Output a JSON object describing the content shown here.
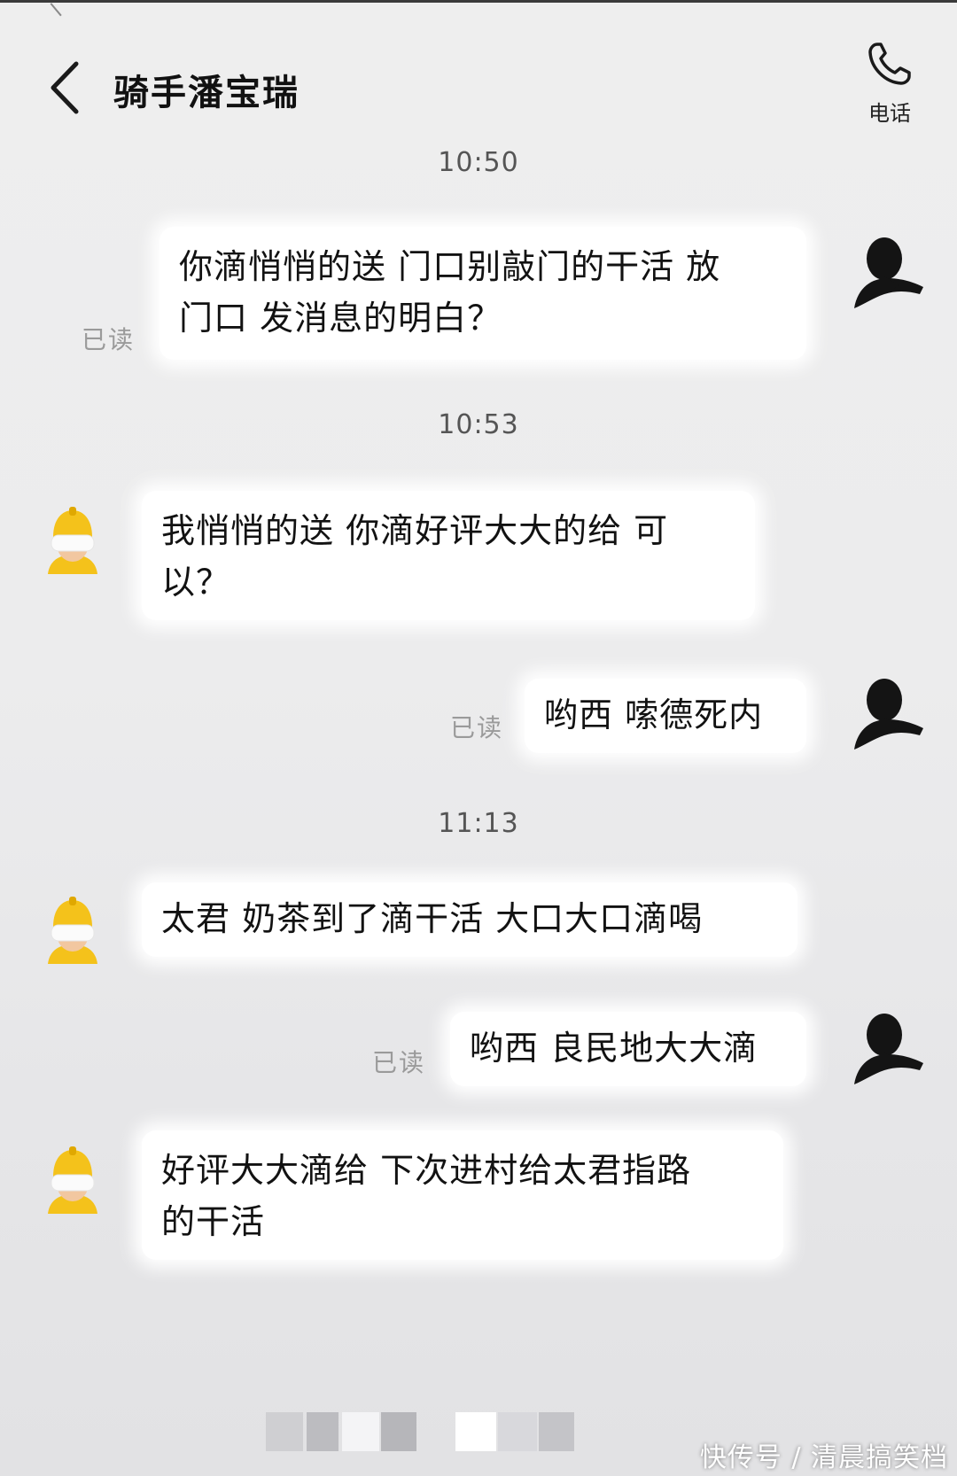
{
  "header": {
    "title": "骑手潘宝瑞",
    "call_label": "电话"
  },
  "timestamps": [
    "10:50",
    "10:53",
    "11:13"
  ],
  "messages": [
    {
      "sender": "me",
      "lines": [
        "你滴悄悄的送 门口别敲门的干活 放",
        "门口 发消息的明白？"
      ],
      "status": "已读"
    },
    {
      "sender": "rider",
      "lines": [
        "我悄悄的送 你滴好评大大的给 可",
        "以？"
      ]
    },
    {
      "sender": "me",
      "lines": [
        "哟西 嗦德死内"
      ],
      "status": "已读"
    },
    {
      "sender": "rider",
      "lines": [
        "太君 奶茶到了滴干活 大口大口滴喝"
      ]
    },
    {
      "sender": "me",
      "lines": [
        "哟西 良民地大大滴"
      ],
      "status": "已读"
    },
    {
      "sender": "rider",
      "lines": [
        "好评大大滴给 下次进村给太君指路",
        "的干活"
      ]
    }
  ],
  "icons": {
    "back": "chevron-left-icon",
    "call": "phone-icon",
    "my_avatar": "silhouette-avatar",
    "rider_avatar": "rider-helmet-avatar"
  },
  "colors": {
    "background": "#ececed",
    "bubble": "#ffffff",
    "read_status": "#9a9a9a",
    "rider_helmet": "#f4c21b"
  },
  "watermark": "快传号 / 清晨搞笑档"
}
